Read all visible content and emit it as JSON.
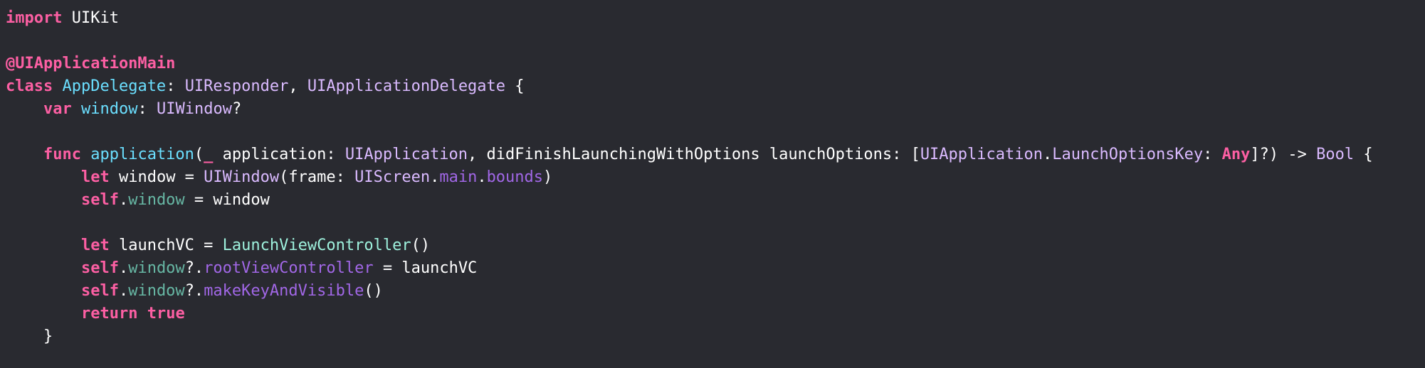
{
  "editor": {
    "background": "#292a30",
    "colors": {
      "keyword": "#fc5fa3",
      "declaration": "#6bdfff",
      "system_type": "#dabaff",
      "property": "#67b7a4",
      "method": "#a167e6",
      "project_type": "#9ef1dd",
      "plain": "#ffffff"
    },
    "lines": [
      [
        {
          "t": "import",
          "c": "kw"
        },
        {
          "t": " UIKit",
          "c": "plain"
        }
      ],
      [],
      [
        {
          "t": "@UIApplicationMain",
          "c": "attr"
        }
      ],
      [
        {
          "t": "class",
          "c": "kw"
        },
        {
          "t": " ",
          "c": "plain"
        },
        {
          "t": "AppDelegate",
          "c": "decl"
        },
        {
          "t": ": ",
          "c": "plain"
        },
        {
          "t": "UIResponder",
          "c": "type"
        },
        {
          "t": ", ",
          "c": "plain"
        },
        {
          "t": "UIApplicationDelegate",
          "c": "type"
        },
        {
          "t": " {",
          "c": "plain"
        }
      ],
      [
        {
          "t": "    ",
          "c": "plain"
        },
        {
          "t": "var",
          "c": "kw"
        },
        {
          "t": " ",
          "c": "plain"
        },
        {
          "t": "window",
          "c": "decl"
        },
        {
          "t": ": ",
          "c": "plain"
        },
        {
          "t": "UIWindow",
          "c": "type"
        },
        {
          "t": "?",
          "c": "plain"
        }
      ],
      [],
      [
        {
          "t": "    ",
          "c": "plain"
        },
        {
          "t": "func",
          "c": "kw"
        },
        {
          "t": " ",
          "c": "plain"
        },
        {
          "t": "application",
          "c": "decl"
        },
        {
          "t": "(",
          "c": "plain"
        },
        {
          "t": "_",
          "c": "kw"
        },
        {
          "t": " application: ",
          "c": "plain"
        },
        {
          "t": "UIApplication",
          "c": "type"
        },
        {
          "t": ", didFinishLaunchingWithOptions launchOptions: [",
          "c": "plain"
        },
        {
          "t": "UIApplication",
          "c": "type"
        },
        {
          "t": ".",
          "c": "plain"
        },
        {
          "t": "LaunchOptionsKey",
          "c": "type"
        },
        {
          "t": ": ",
          "c": "plain"
        },
        {
          "t": "Any",
          "c": "kw"
        },
        {
          "t": "]?) -> ",
          "c": "plain"
        },
        {
          "t": "Bool",
          "c": "type"
        },
        {
          "t": " {",
          "c": "plain"
        }
      ],
      [
        {
          "t": "        ",
          "c": "plain"
        },
        {
          "t": "let",
          "c": "kw"
        },
        {
          "t": " window = ",
          "c": "plain"
        },
        {
          "t": "UIWindow",
          "c": "type"
        },
        {
          "t": "(frame: ",
          "c": "plain"
        },
        {
          "t": "UIScreen",
          "c": "type"
        },
        {
          "t": ".",
          "c": "plain"
        },
        {
          "t": "main",
          "c": "method"
        },
        {
          "t": ".",
          "c": "plain"
        },
        {
          "t": "bounds",
          "c": "method"
        },
        {
          "t": ")",
          "c": "plain"
        }
      ],
      [
        {
          "t": "        ",
          "c": "plain"
        },
        {
          "t": "self",
          "c": "kw"
        },
        {
          "t": ".",
          "c": "plain"
        },
        {
          "t": "window",
          "c": "prop"
        },
        {
          "t": " = window",
          "c": "plain"
        }
      ],
      [],
      [
        {
          "t": "        ",
          "c": "plain"
        },
        {
          "t": "let",
          "c": "kw"
        },
        {
          "t": " launchVC = ",
          "c": "plain"
        },
        {
          "t": "LaunchViewController",
          "c": "projtype"
        },
        {
          "t": "()",
          "c": "plain"
        }
      ],
      [
        {
          "t": "        ",
          "c": "plain"
        },
        {
          "t": "self",
          "c": "kw"
        },
        {
          "t": ".",
          "c": "plain"
        },
        {
          "t": "window",
          "c": "prop"
        },
        {
          "t": "?.",
          "c": "plain"
        },
        {
          "t": "rootViewController",
          "c": "method"
        },
        {
          "t": " = launchVC",
          "c": "plain"
        }
      ],
      [
        {
          "t": "        ",
          "c": "plain"
        },
        {
          "t": "self",
          "c": "kw"
        },
        {
          "t": ".",
          "c": "plain"
        },
        {
          "t": "window",
          "c": "prop"
        },
        {
          "t": "?.",
          "c": "plain"
        },
        {
          "t": "makeKeyAndVisible",
          "c": "method"
        },
        {
          "t": "()",
          "c": "plain"
        }
      ],
      [
        {
          "t": "        ",
          "c": "plain"
        },
        {
          "t": "return",
          "c": "kw"
        },
        {
          "t": " ",
          "c": "plain"
        },
        {
          "t": "true",
          "c": "kw"
        }
      ],
      [
        {
          "t": "    }",
          "c": "plain"
        }
      ]
    ]
  }
}
